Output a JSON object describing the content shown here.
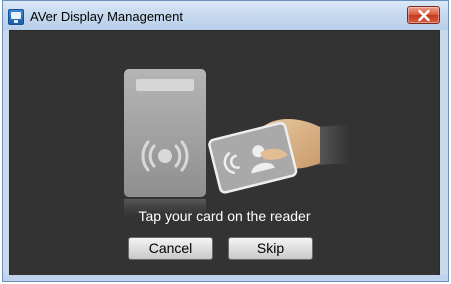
{
  "window": {
    "title": "AVer Display Management",
    "app_icon": "display-management-app-icon",
    "close_icon": "close-x-icon"
  },
  "illustration": {
    "reader_icon": "card-reader-icon",
    "card_icon": "contactless-card-icon",
    "hand_icon": "hand-holding-card-icon"
  },
  "dialog": {
    "prompt": "Tap your card on the reader",
    "cancel_label": "Cancel",
    "skip_label": "Skip"
  },
  "colors": {
    "content_background": "#333333",
    "titlebar": "#c7d9ef",
    "close_button": "#d9553a",
    "text": "#ffffff"
  }
}
